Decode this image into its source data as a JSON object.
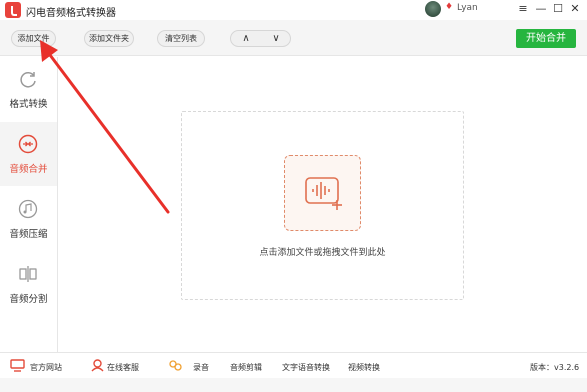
{
  "app": {
    "title": "闪电音频格式转换器"
  },
  "user": {
    "name": "Lyan"
  },
  "window_controls": {
    "menu": "≡",
    "minimize": "—",
    "maximize": "☐",
    "close": "✕"
  },
  "toolbar": {
    "add_file": "添加文件",
    "add_folder": "添加文件夹",
    "clear_list": "清空列表",
    "move_up": "∧",
    "move_down": "∨",
    "start_merge": "开始合并"
  },
  "sidebar": {
    "items": [
      {
        "label": "格式转换",
        "icon": "format-convert-icon"
      },
      {
        "label": "音频合并",
        "icon": "audio-merge-icon",
        "active": true
      },
      {
        "label": "音频压缩",
        "icon": "audio-compress-icon"
      },
      {
        "label": "音频分割",
        "icon": "audio-split-icon"
      }
    ]
  },
  "main": {
    "drop_hint": "点击添加文件或拖拽文件到此处"
  },
  "footer": {
    "website": "官方网站",
    "support": "在线客服",
    "record": "录音",
    "audio_edit": "音频剪辑",
    "tts": "文字语音转换",
    "video_convert": "视频转换",
    "version": "版本：v3.2.6"
  },
  "colors": {
    "accent": "#e34b3a",
    "primary_green": "#26b53f",
    "annotation_arrow": "#e8302a"
  }
}
